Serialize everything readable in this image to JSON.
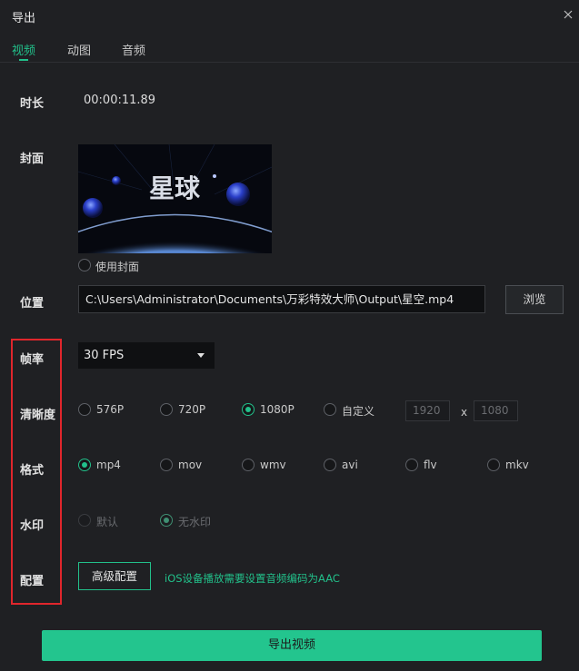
{
  "dialog": {
    "title": "导出"
  },
  "tabs": [
    {
      "label": "视频",
      "active": true
    },
    {
      "label": "动图",
      "active": false
    },
    {
      "label": "音频",
      "active": false
    }
  ],
  "duration": {
    "label": "时长",
    "value": "00:00:11.89"
  },
  "cover": {
    "label": "封面",
    "thumbnail_text": "星球",
    "use_cover_label": "使用封面",
    "use_cover_checked": false
  },
  "location": {
    "label": "位置",
    "path": "C:\\Users\\Administrator\\Documents\\万彩特效大师\\Output\\星空.mp4",
    "browse_label": "浏览"
  },
  "frame_rate": {
    "label": "帧率",
    "selected": "30 FPS"
  },
  "resolution": {
    "label": "清晰度",
    "options": [
      "576P",
      "720P",
      "1080P",
      "自定义"
    ],
    "selected": "1080P",
    "custom_width": "1920",
    "separator": "x",
    "custom_height": "1080"
  },
  "format": {
    "label": "格式",
    "options": [
      "mp4",
      "mov",
      "wmv",
      "avi",
      "flv",
      "mkv"
    ],
    "selected": "mp4"
  },
  "watermark": {
    "label": "水印",
    "options": [
      "默认",
      "无水印"
    ],
    "selected": "无水印",
    "disabled": true
  },
  "config": {
    "label": "配置",
    "advanced_label": "高级配置",
    "hint": "iOS设备播放需要设置音频编码为AAC"
  },
  "export_button": {
    "label": "导出视频"
  },
  "colors": {
    "accent": "#22c08a",
    "highlight_box": "#e0262c",
    "background": "#1f2023"
  }
}
